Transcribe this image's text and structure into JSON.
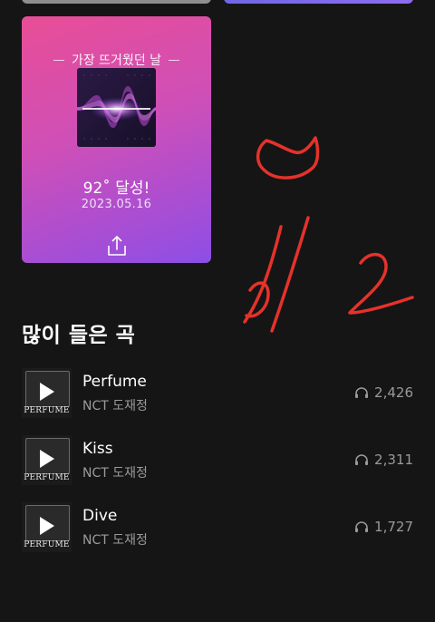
{
  "hot_card": {
    "title": "가장 뜨거웠던 날",
    "achievement": "92˚ 달성!",
    "date": "2023.05.16",
    "share_icon": "share-icon"
  },
  "section": {
    "title": "많이 들은 곡"
  },
  "tracks": [
    {
      "title": "Perfume",
      "artist": "NCT 도재정",
      "plays": "2,426",
      "cover_text": "PERFUME"
    },
    {
      "title": "Kiss",
      "artist": "NCT 도재정",
      "plays": "2,311",
      "cover_text": "PERFUME"
    },
    {
      "title": "Dive",
      "artist": "NCT 도재정",
      "plays": "1,727",
      "cover_text": "PERFUME"
    }
  ],
  "colors": {
    "background": "#151515",
    "annotation": "#e5322b",
    "card_gradient_start": "#e94e96",
    "card_gradient_end": "#8c4fe6"
  }
}
